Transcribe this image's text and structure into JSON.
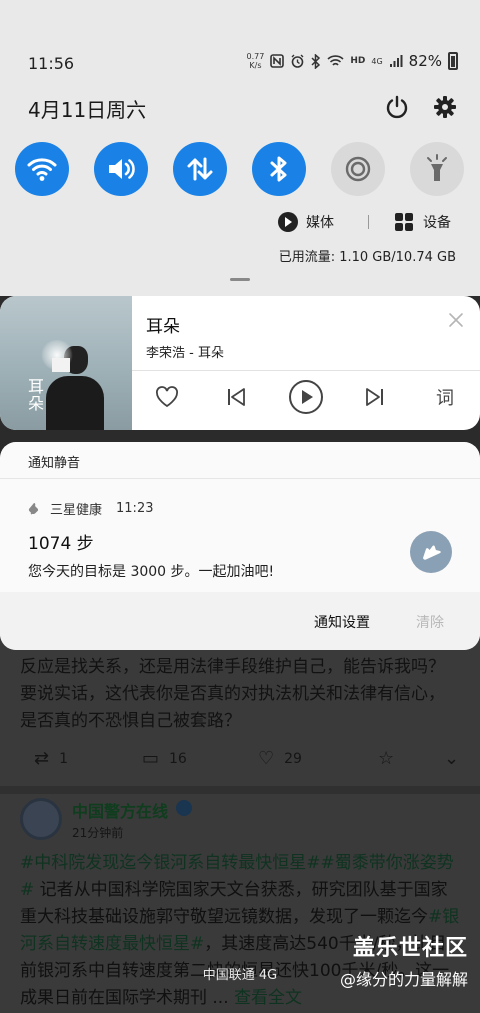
{
  "status_bar": {
    "time": "11:56",
    "net_speed_value": "0.77",
    "net_speed_unit": "K/s",
    "network_type": "4G",
    "battery": "82%"
  },
  "quick_panel": {
    "date": "4月11日周六",
    "tiles": [
      {
        "name": "wifi",
        "state": "on"
      },
      {
        "name": "sound",
        "state": "on"
      },
      {
        "name": "mobile-data",
        "state": "on"
      },
      {
        "name": "bluetooth",
        "state": "on"
      },
      {
        "name": "location",
        "state": "off"
      },
      {
        "name": "flashlight",
        "state": "off"
      }
    ],
    "media_label": "媒体",
    "devices_label": "设备",
    "data_usage": "已用流量: 1.10 GB/10.74 GB",
    "accent_color": "#1a82e6"
  },
  "music": {
    "album_text": "耳朵",
    "title": "耳朵",
    "artist": "李荣浩 - 耳朵",
    "lyrics_label": "词"
  },
  "notifications": {
    "mute_header": "通知静音",
    "app_name": "三星健康",
    "app_time": "11:23",
    "steps": "1074 步",
    "goal_text": "您今天的目标是 3000 步。一起加油吧!",
    "settings_label": "通知设置",
    "clear_label": "清除"
  },
  "background_app": {
    "post_text": "反应是找关系，还是用法律手段维护自己，能告诉我吗？要说实话，这代表你是否真的对执法机关和法律有信心，是否真的不恐惧自己被套路？",
    "repost_count": "1",
    "comment_count": "16",
    "like_count": "29",
    "account_name": "中国警方在线",
    "account_time": "21分钟前",
    "tag1": "#中科院发现迄今银河系自转最快恒星#",
    "tag2": "#蜀黍带你涨姿势#",
    "body_part1": " 记者从中国科学院国家天文台获悉，研究团队基于国家重大科技基础设施郭守敬望远镜数据，发现了一颗迄今",
    "tag3": "#银河系自转速度最快恒星#",
    "body_part2": "，其速度高达540千米/秒，比目前银河系中自转速度第二快的恒星还快100千米/秒。这一成果日前在国际学术期刊 ... ",
    "more_label": "查看全文"
  },
  "system": {
    "carrier": "中国联通 4G",
    "watermark_title": "盖乐世社区",
    "watermark_user": "@缘分的力量解解"
  }
}
